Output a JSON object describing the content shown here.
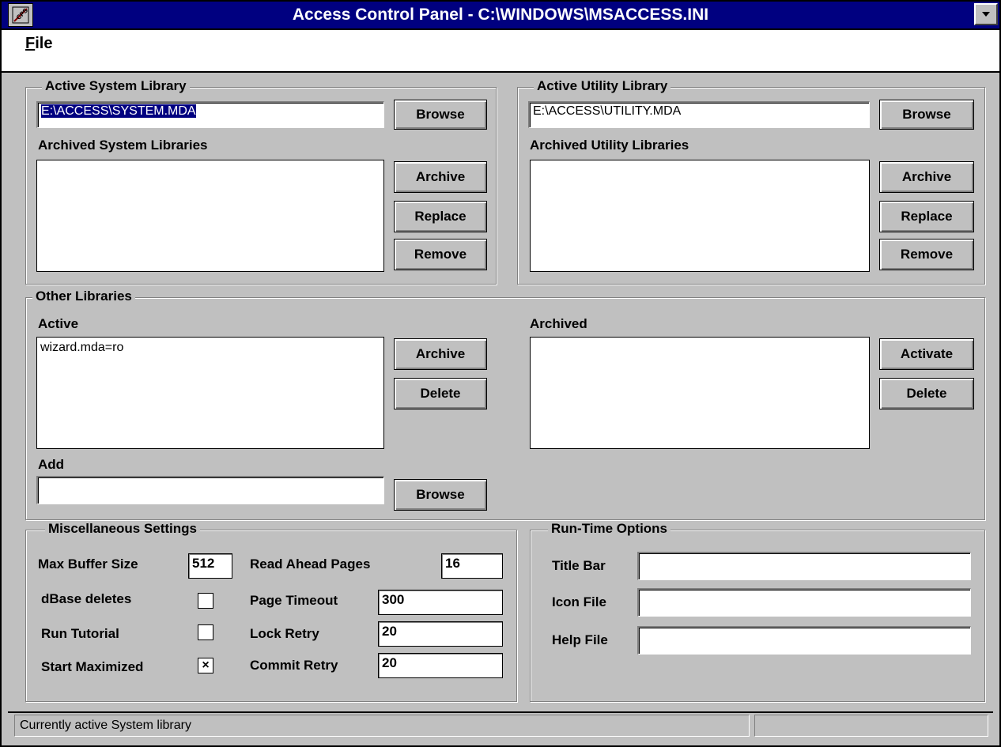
{
  "window": {
    "title": "Access Control Panel - C:\\WINDOWS\\MSACCESS.INI"
  },
  "icons": {
    "system_menu": "cps-app-icon",
    "dropdown": "down-arrow-icon"
  },
  "menu": {
    "file_first": "F",
    "file_rest": "ile"
  },
  "system_library": {
    "group_label": "Active System Library",
    "active_value": "E:\\ACCESS\\SYSTEM.MDA",
    "browse": "Browse",
    "archived_label": "Archived System Libraries",
    "archive": "Archive",
    "replace": "Replace",
    "remove": "Remove"
  },
  "utility_library": {
    "group_label": "Active Utility Library",
    "active_value": "E:\\ACCESS\\UTILITY.MDA",
    "browse": "Browse",
    "archived_label": "Archived Utility Libraries",
    "archive": "Archive",
    "replace": "Replace",
    "remove": "Remove"
  },
  "other_libraries": {
    "group_label": "Other Libraries",
    "active_label": "Active",
    "active_items": [
      "wizard.mda=ro"
    ],
    "archive": "Archive",
    "delete_active": "Delete",
    "archived_label": "Archived",
    "activate": "Activate",
    "delete_archived": "Delete",
    "add_label": "Add",
    "add_value": "",
    "browse": "Browse"
  },
  "misc": {
    "group_label": "Miscellaneous Settings",
    "max_buffer_label": "Max Buffer Size",
    "max_buffer_value": "512",
    "read_ahead_label": "Read Ahead Pages",
    "read_ahead_value": "16",
    "dbase_deletes_label": "dBase deletes",
    "dbase_deletes_checked": false,
    "page_timeout_label": "Page Timeout",
    "page_timeout_value": "300",
    "run_tutorial_label": "Run Tutorial",
    "run_tutorial_checked": false,
    "lock_retry_label": "Lock Retry",
    "lock_retry_value": "20",
    "start_maximized_label": "Start Maximized",
    "start_maximized_checked": true,
    "start_maximized_mark": "×",
    "commit_retry_label": "Commit Retry",
    "commit_retry_value": "20"
  },
  "runtime": {
    "group_label": "Run-Time Options",
    "title_bar_label": "Title Bar",
    "title_bar_value": "",
    "icon_file_label": "Icon File",
    "icon_file_value": "",
    "help_file_label": "Help File",
    "help_file_value": ""
  },
  "status": {
    "text": "Currently active System library"
  },
  "colors": {
    "titlebar": "#000080",
    "face": "#c0c0c0",
    "selection": "#000080"
  }
}
